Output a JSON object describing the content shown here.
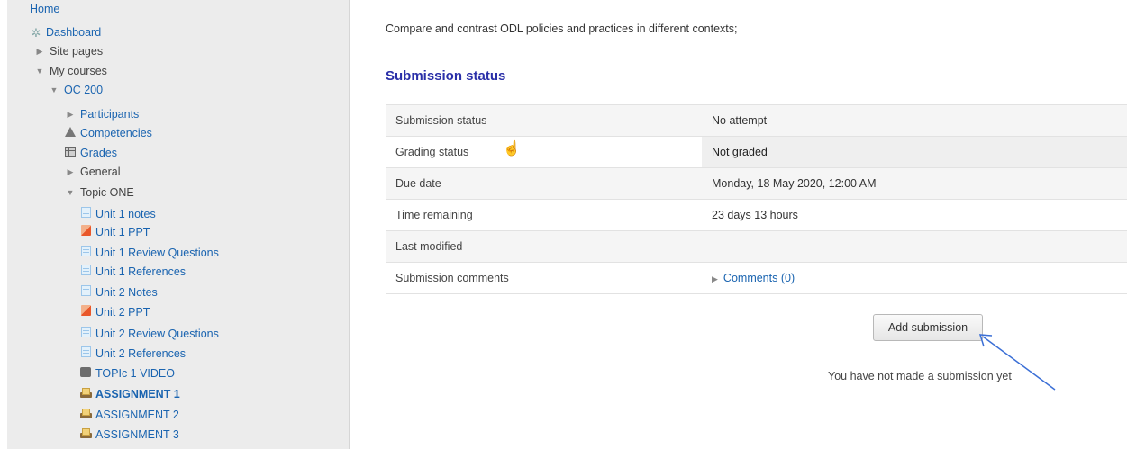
{
  "sidebar": {
    "home": "Home",
    "dashboard": "Dashboard",
    "site_pages": "Site pages",
    "my_courses": "My courses",
    "course": "OC 200",
    "participants": "Participants",
    "competencies": "Competencies",
    "grades": "Grades",
    "general": "General",
    "topic": "Topic ONE",
    "items": [
      {
        "label": "Unit 1 notes",
        "icon": "document-icon"
      },
      {
        "label": "Unit 1 PPT",
        "icon": "powerpoint-icon"
      },
      {
        "label": "Unit 1 Review Questions",
        "icon": "document-icon"
      },
      {
        "label": "Unit 1 References",
        "icon": "document-icon"
      },
      {
        "label": "Unit 2 Notes",
        "icon": "document-icon"
      },
      {
        "label": "Unit 2 PPT",
        "icon": "powerpoint-icon"
      },
      {
        "label": "Unit 2 Review Questions",
        "icon": "document-icon"
      },
      {
        "label": "Unit 2 References",
        "icon": "document-icon"
      },
      {
        "label": "TOPIc 1 VIDEO",
        "icon": "video-icon"
      },
      {
        "label": "ASSIGNMENT 1",
        "icon": "assignment-icon",
        "active": true
      },
      {
        "label": "ASSIGNMENT 2",
        "icon": "assignment-icon"
      },
      {
        "label": "ASSIGNMENT 3",
        "icon": "assignment-icon"
      }
    ]
  },
  "main": {
    "intro": "Compare and contrast ODL policies and practices in different contexts;",
    "heading": "Submission status",
    "rows": [
      {
        "label": "Submission status",
        "value": "No attempt"
      },
      {
        "label": "Grading status",
        "value": "Not graded"
      },
      {
        "label": "Due date",
        "value": "Monday, 18 May 2020, 12:00 AM"
      },
      {
        "label": "Time remaining",
        "value": "23 days 13 hours"
      },
      {
        "label": "Last modified",
        "value": "-"
      },
      {
        "label": "Submission comments",
        "value": "Comments (0)"
      }
    ],
    "add_submission_label": "Add submission",
    "no_submission_text": "You have not made a submission yet"
  },
  "colors": {
    "link": "#1a64b0",
    "heading": "#2a2fa8",
    "sidebar_bg": "#ececec",
    "annotation_arrow": "#3b6fd6"
  }
}
